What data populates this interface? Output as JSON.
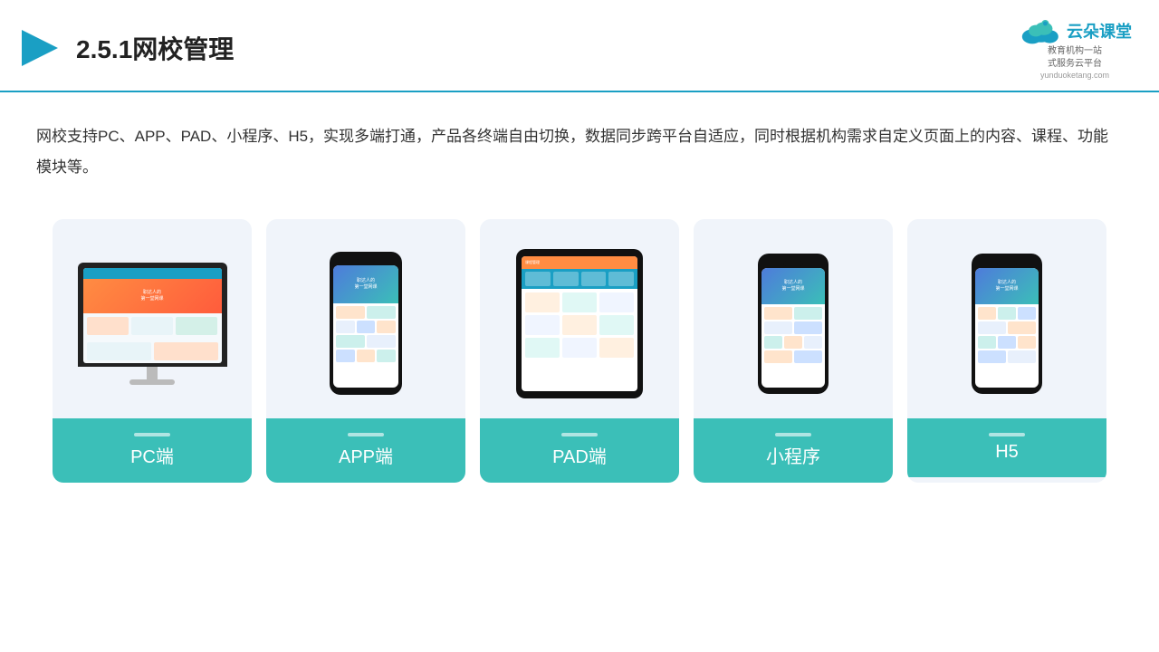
{
  "header": {
    "section_number": "2.5.1",
    "title": "网校管理",
    "logo_name": "云朵课堂",
    "logo_url": "yunduoketang.com",
    "logo_tagline": "教育机构一站\n式服务云平台"
  },
  "description": {
    "text": "网校支持PC、APP、PAD、小程序、H5，实现多端打通，产品各终端自由切换，数据同步跨平台自适应，同时根据机构需求自定义页面上的内容、课程、功能模块等。"
  },
  "cards": [
    {
      "id": "pc",
      "label": "PC端"
    },
    {
      "id": "app",
      "label": "APP端"
    },
    {
      "id": "pad",
      "label": "PAD端"
    },
    {
      "id": "miniprogram",
      "label": "小程序"
    },
    {
      "id": "h5",
      "label": "H5"
    }
  ]
}
